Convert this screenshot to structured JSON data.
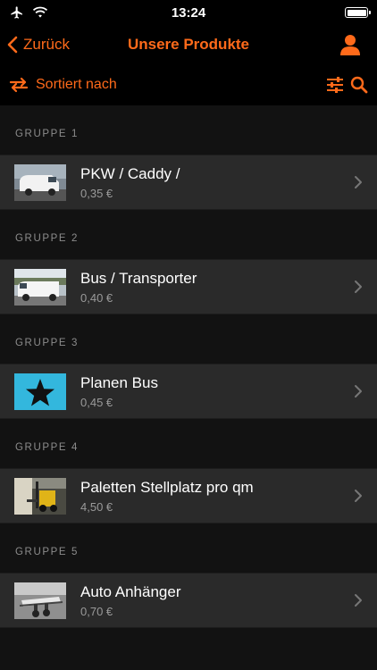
{
  "status_bar": {
    "time": "13:24"
  },
  "nav": {
    "back_label": "Zurück",
    "title": "Unsere Produkte"
  },
  "toolbar": {
    "sort_label": "Sortiert nach"
  },
  "groups": [
    {
      "header": "GRUPPE 1",
      "item": {
        "title": "PKW / Caddy /",
        "price": "0,35 €",
        "thumb": "van-photo"
      }
    },
    {
      "header": "GRUPPE 2",
      "item": {
        "title": "Bus / Transporter",
        "price": "0,40 €",
        "thumb": "transporter-photo"
      }
    },
    {
      "header": "GRUPPE 3",
      "item": {
        "title": "Planen Bus",
        "price": "0,45 €",
        "thumb": "star-icon"
      }
    },
    {
      "header": "GRUPPE 4",
      "item": {
        "title": "Paletten Stellplatz pro qm",
        "price": "4,50 €",
        "thumb": "forklift-photo"
      }
    },
    {
      "header": "GRUPPE 5",
      "item": {
        "title": "Auto Anhänger",
        "price": "0,70 €",
        "thumb": "trailer-photo"
      }
    }
  ],
  "colors": {
    "accent": "#ff6a1a",
    "background": "#121212",
    "row": "#2a2a2a",
    "bar": "#000000",
    "star_tile": "#33b7dd"
  }
}
